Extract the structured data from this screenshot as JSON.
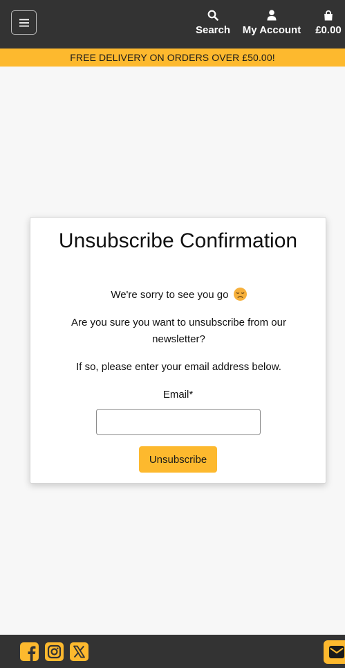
{
  "header": {
    "menu_icon": "hamburger-menu-icon",
    "search_label": "Search",
    "account_label": "My Account",
    "basket_total": "£0.00"
  },
  "banner": {
    "text": "FREE DELIVERY ON ORDERS OVER £50.00!"
  },
  "card": {
    "title": "Unsubscribe Confirmation",
    "sorry_text": "We're sorry to see you go",
    "question_text": "Are you sure you want to unsubscribe from our newsletter?",
    "instruction_text": "If so, please enter your email address below.",
    "email_label": "Email*",
    "email_value": "",
    "email_placeholder": "",
    "submit_label": "Unsubscribe"
  },
  "footer": {
    "social": [
      "facebook-icon",
      "instagram-icon",
      "x-icon"
    ],
    "mail_icon": "envelope-icon"
  },
  "colors": {
    "dark_bar": "#333333",
    "accent": "#fdb92e",
    "page_bg": "#f7f7f7"
  }
}
